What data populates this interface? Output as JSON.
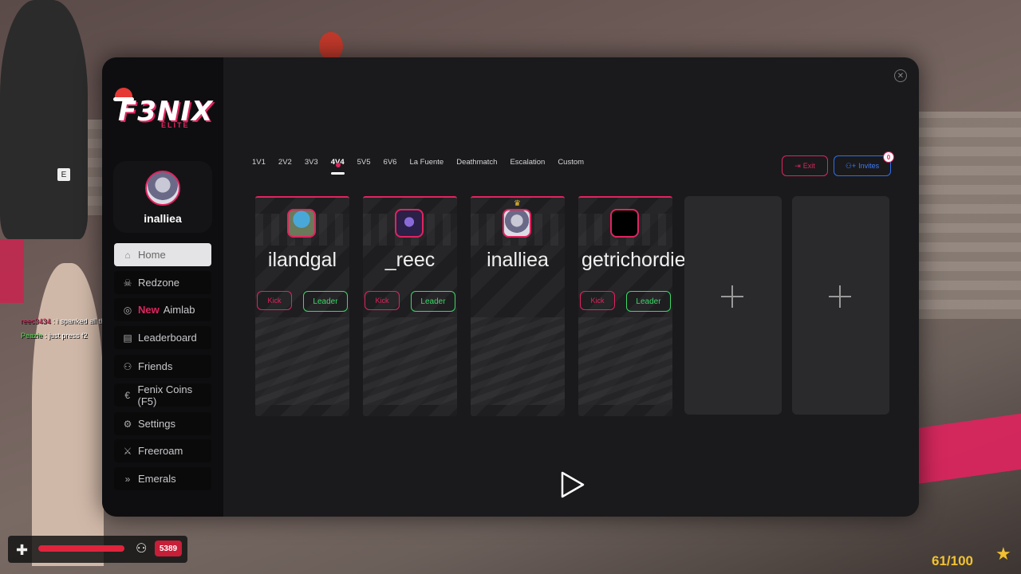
{
  "brand": {
    "logo_text": "F3NIX",
    "logo_sub": "ELITE",
    "accent": "#e0245e"
  },
  "profile": {
    "username": "inalliea"
  },
  "sidebar": {
    "items": [
      {
        "label": "Home",
        "icon": "home-icon",
        "active": true
      },
      {
        "label": "Redzone",
        "icon": "skull-icon"
      },
      {
        "label": "Aimlab",
        "icon": "target-icon",
        "tag": "New"
      },
      {
        "label": "Leaderboard",
        "icon": "clipboard-icon"
      },
      {
        "label": "Friends",
        "icon": "users-icon"
      },
      {
        "label": "Fenix Coins (F5)",
        "icon": "euro-icon"
      },
      {
        "label": "Settings",
        "icon": "gear-icon"
      },
      {
        "label": "Freeroam",
        "icon": "swords-icon"
      },
      {
        "label": "Emerals",
        "icon": "chevrons-right-icon"
      }
    ]
  },
  "tabs": [
    "1V1",
    "2V2",
    "3V3",
    "4V4",
    "5V5",
    "6V6",
    "La Fuente",
    "Deathmatch",
    "Escalation",
    "Custom"
  ],
  "active_tab": "4V4",
  "actions": {
    "exit_label": "Exit",
    "invites_label": "Invites",
    "invites_count": "0"
  },
  "party": {
    "members": [
      {
        "name": "ilandgal",
        "kick": "Kick",
        "leader": "Leader"
      },
      {
        "name": "_reec",
        "kick": "Kick",
        "leader": "Leader"
      },
      {
        "name": "inalliea",
        "is_leader": true
      },
      {
        "name": "getrichordieslime",
        "kick": "Kick",
        "leader": "Leader"
      }
    ],
    "empty_slots": 2
  },
  "hud": {
    "money": "5389",
    "ammo": "61/100"
  },
  "chat": [
    {
      "user": "reec3434",
      "message": "i spanked all they ass"
    },
    {
      "user": "Peazie",
      "message": "just press f2"
    }
  ],
  "prompt_key": "E"
}
